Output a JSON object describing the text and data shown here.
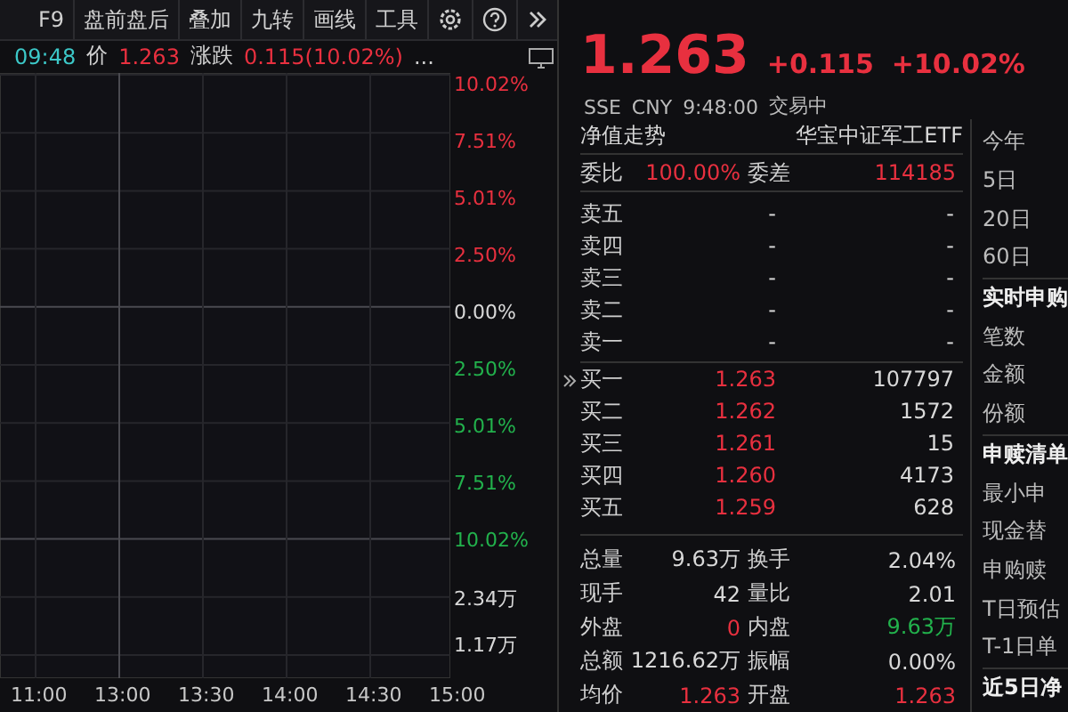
{
  "toolbar": {
    "items": [
      "F9",
      "盘前盘后",
      "叠加",
      "九转",
      "画线",
      "工具"
    ]
  },
  "info_bar": {
    "time": "09:48",
    "price_label": "价",
    "price": "1.263",
    "change_label": "涨跌",
    "change": "0.115(10.02%)",
    "more": "..."
  },
  "axis_labels": [
    {
      "text": "10.02%",
      "kind": "up"
    },
    {
      "text": "7.51%",
      "kind": "up"
    },
    {
      "text": "5.01%",
      "kind": "up"
    },
    {
      "text": "2.50%",
      "kind": "up"
    },
    {
      "text": "0.00%",
      "kind": "flat"
    },
    {
      "text": "2.50%",
      "kind": "down"
    },
    {
      "text": "5.01%",
      "kind": "down"
    },
    {
      "text": "7.51%",
      "kind": "down"
    },
    {
      "text": "10.02%",
      "kind": "down"
    },
    {
      "text": "2.34万",
      "kind": "volume"
    },
    {
      "text": "1.17万",
      "kind": "volume"
    }
  ],
  "time_axis": [
    "11:00",
    "13:00",
    "13:30",
    "14:00",
    "14:30",
    "15:00"
  ],
  "quote": {
    "price": "1.263",
    "change": "+0.115",
    "percent": "+10.02%",
    "exchange": "SSE",
    "currency": "CNY",
    "time": "9:48:00",
    "status": "交易中"
  },
  "fund_header": {
    "left": "净值走势",
    "right": "华宝中证军工ETF"
  },
  "order_ratio": {
    "label": "委比",
    "value": "100.00%",
    "diff_label": "委差",
    "diff": "114185"
  },
  "asks": [
    {
      "label": "卖五",
      "price": "-",
      "volume": "-"
    },
    {
      "label": "卖四",
      "price": "-",
      "volume": "-"
    },
    {
      "label": "卖三",
      "price": "-",
      "volume": "-"
    },
    {
      "label": "卖二",
      "price": "-",
      "volume": "-"
    },
    {
      "label": "卖一",
      "price": "-",
      "volume": "-"
    }
  ],
  "bids": [
    {
      "label": "买一",
      "price": "1.263",
      "volume": "107797"
    },
    {
      "label": "买二",
      "price": "1.262",
      "volume": "1572"
    },
    {
      "label": "买三",
      "price": "1.261",
      "volume": "15"
    },
    {
      "label": "买四",
      "price": "1.260",
      "volume": "4173"
    },
    {
      "label": "买五",
      "price": "1.259",
      "volume": "628"
    }
  ],
  "stats": [
    {
      "cells": [
        {
          "label": "总量",
          "value": "9.63万",
          "color": "#d8d8d8"
        },
        {
          "label": "换手",
          "value": "2.04%",
          "color": "#d8d8d8"
        }
      ]
    },
    {
      "cells": [
        {
          "label": "现手",
          "value": "42",
          "color": "#d8d8d8"
        },
        {
          "label": "量比",
          "value": "2.01",
          "color": "#d8d8d8"
        }
      ]
    },
    {
      "cells": [
        {
          "label": "外盘",
          "value": "0",
          "color": "#e8303f"
        },
        {
          "label": "内盘",
          "value": "9.63万",
          "color": "#22b14c"
        }
      ]
    },
    {
      "cells": [
        {
          "label": "总额",
          "value": "1216.62万",
          "color": "#d8d8d8"
        },
        {
          "label": "振幅",
          "value": "0.00%",
          "color": "#d8d8d8"
        }
      ]
    },
    {
      "cells": [
        {
          "label": "均价",
          "value": "1.263",
          "color": "#e8303f"
        },
        {
          "label": "开盘",
          "value": "1.263",
          "color": "#e8303f"
        }
      ]
    }
  ],
  "side": [
    {
      "text": "今年",
      "kind": "item"
    },
    {
      "text": "5日",
      "kind": "item"
    },
    {
      "text": "20日",
      "kind": "item"
    },
    {
      "text": "60日",
      "kind": "item"
    },
    {
      "text": "实时申购",
      "kind": "header"
    },
    {
      "text": "笔数",
      "kind": "item"
    },
    {
      "text": "金额",
      "kind": "item"
    },
    {
      "text": "份额",
      "kind": "item"
    },
    {
      "text": "申赎清单",
      "kind": "header"
    },
    {
      "text": "最小申",
      "kind": "item"
    },
    {
      "text": "现金替",
      "kind": "item"
    },
    {
      "text": "申购赎",
      "kind": "item"
    },
    {
      "text": "T日预估",
      "kind": "item"
    },
    {
      "text": "T-1日单",
      "kind": "item"
    },
    {
      "text": "近5日净",
      "kind": "header"
    }
  ]
}
